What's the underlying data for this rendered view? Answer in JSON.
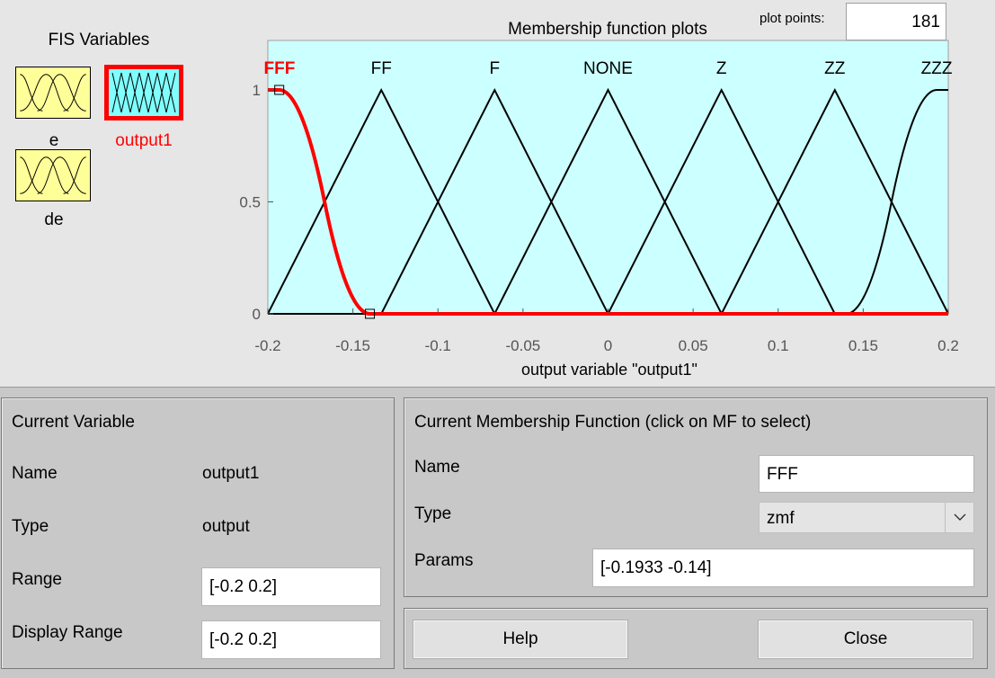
{
  "fis_panel": {
    "title": "FIS Variables",
    "variables": [
      {
        "name": "e",
        "selected": false,
        "icon": "input-mf-icon"
      },
      {
        "name": "output1",
        "selected": true,
        "icon": "output-mf-icon"
      },
      {
        "name": "de",
        "selected": false,
        "icon": "input-mf-icon"
      }
    ]
  },
  "plot": {
    "title": "Membership function plots",
    "plot_points_label": "plot points:",
    "plot_points_value": "181",
    "xlabel": "output variable \"output1\"",
    "x_ticks": [
      "-0.2",
      "-0.15",
      "-0.1",
      "-0.05",
      "0",
      "0.05",
      "0.1",
      "0.15",
      "0.2"
    ],
    "y_ticks": [
      "0",
      "0.5",
      "1"
    ],
    "background_color": "#ccffff",
    "selected_color": "#ff0000"
  },
  "chart_data": {
    "type": "line",
    "x_range": [
      -0.2,
      0.2
    ],
    "y_range": [
      0,
      1
    ],
    "series": [
      {
        "name": "FFF",
        "mf_type": "zmf",
        "params": [
          -0.1933,
          -0.14
        ],
        "selected": true
      },
      {
        "name": "FF",
        "mf_type": "trimf",
        "params": [
          -0.2,
          -0.1333,
          -0.0667
        ]
      },
      {
        "name": "F",
        "mf_type": "trimf",
        "params": [
          -0.1333,
          -0.0667,
          0
        ]
      },
      {
        "name": "NONE",
        "mf_type": "trimf",
        "params": [
          -0.0667,
          0,
          0.0667
        ]
      },
      {
        "name": "Z",
        "mf_type": "trimf",
        "params": [
          0,
          0.0667,
          0.1333
        ]
      },
      {
        "name": "ZZ",
        "mf_type": "trimf",
        "params": [
          0.0667,
          0.1333,
          0.2
        ]
      },
      {
        "name": "ZZZ",
        "mf_type": "smf",
        "params": [
          0.14,
          0.1933
        ]
      }
    ]
  },
  "current_variable": {
    "title": "Current Variable",
    "name_label": "Name",
    "name_value": "output1",
    "type_label": "Type",
    "type_value": "output",
    "range_label": "Range",
    "range_value": "[-0.2 0.2]",
    "display_range_label": "Display Range",
    "display_range_value": "[-0.2 0.2]"
  },
  "current_mf": {
    "title": "Current Membership Function (click on MF to select)",
    "name_label": "Name",
    "name_value": "FFF",
    "type_label": "Type",
    "type_value": "zmf",
    "params_label": "Params",
    "params_value": "[-0.1933 -0.14]"
  },
  "buttons": {
    "help": "Help",
    "close": "Close"
  }
}
